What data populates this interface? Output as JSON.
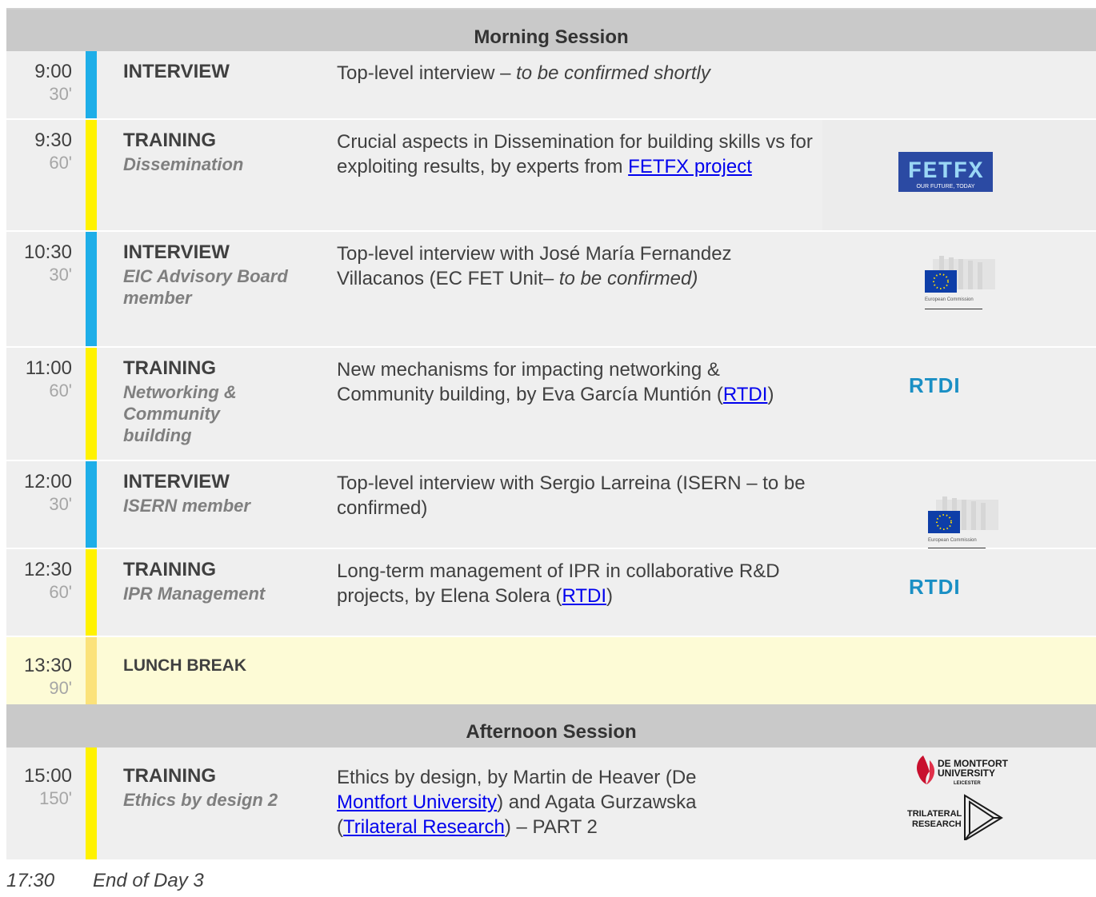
{
  "sessions": {
    "morning": "Morning Session",
    "afternoon": "Afternoon Session"
  },
  "rows": [
    {
      "time": "9:00",
      "dur": "30'",
      "type": "INTERVIEW",
      "sub": "",
      "desc_a": "Top-level interview – ",
      "desc_b": "to be confirmed shortly"
    },
    {
      "time": "9:30",
      "dur": "60'",
      "type": "TRAINING",
      "sub": "Dissemination",
      "desc_a": "Crucial aspects in Dissemination for building skills vs for exploiting results, by experts from ",
      "link": "FETFX project"
    },
    {
      "time": "10:30",
      "dur": "30'",
      "type": "INTERVIEW",
      "sub": "EIC Advisory Board member",
      "desc_a": "Top-level interview with José María Fernandez Villacanos (EC FET Unit– ",
      "desc_b": "to be confirmed)"
    },
    {
      "time": "11:00",
      "dur": "60'",
      "type": "TRAINING",
      "sub": "Networking & Community building",
      "desc_a": "New mechanisms for impacting networking & Community building, by Eva García Muntión (",
      "link": "RTDI",
      "desc_c": ")"
    },
    {
      "time": "12:00",
      "dur": "30'",
      "type": "INTERVIEW",
      "sub": "ISERN member",
      "desc_a": "Top-level interview with Sergio Larreina (ISERN – to be confirmed)"
    },
    {
      "time": "12:30",
      "dur": "60'",
      "type": "TRAINING",
      "sub": "IPR Management",
      "desc_a": "Long-term management of IPR in collaborative R&D projects, by Elena Solera (",
      "link": "RTDI",
      "desc_c": ")"
    },
    {
      "time": "13:30",
      "dur": "90'",
      "type": "LUNCH BREAK"
    },
    {
      "time": "15:00",
      "dur": "150'",
      "type": "TRAINING",
      "sub": "Ethics by design 2",
      "desc_a": "Ethics by design, by Martin de Heaver (De ",
      "link": "Montfort University",
      "desc_b": ") and Agata Gurzawska (",
      "link2": "Trilateral Research",
      "desc_c": ") – PART 2"
    }
  ],
  "logos": {
    "fetfx_main": "FETFX",
    "fetfx_tag": "OUR FUTURE, TODAY",
    "ec_text": "European Commission",
    "rtdi": "RTDI",
    "dmu_line1": "DE MONTFORT",
    "dmu_line2": "UNIVERSITY",
    "dmu_line3": "LEICESTER",
    "tri_line1": "TRILATERAL",
    "tri_line2": "RESEARCH"
  },
  "footer": {
    "time": "17:30",
    "label": "End of Day 3"
  },
  "colors": {
    "interview_bar": "#1eaee8",
    "training_bar": "#fff200",
    "lunch_bg": "#fdfbd6",
    "link": "#0000ee"
  }
}
